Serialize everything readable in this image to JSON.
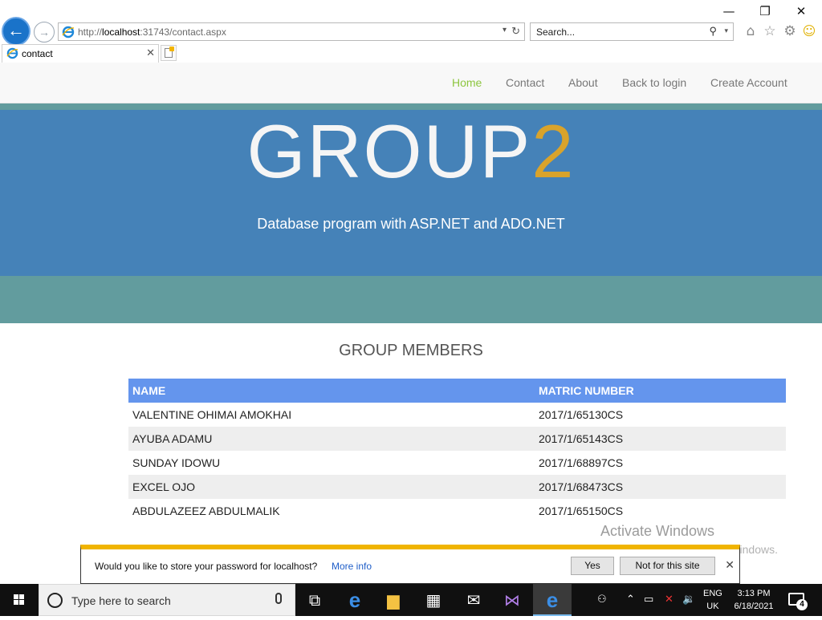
{
  "browser": {
    "url_prefix": "http://",
    "url_host": "localhost",
    "url_rest": ":31743/contact.aspx",
    "search_placeholder": "Search...",
    "tab_title": "contact"
  },
  "nav": {
    "items": [
      {
        "label": "Home",
        "active": true
      },
      {
        "label": "Contact"
      },
      {
        "label": "About"
      },
      {
        "label": "Back to login"
      },
      {
        "label": "Create Account"
      }
    ]
  },
  "hero": {
    "title_text": "GROUP",
    "title_digit": "2",
    "subtitle": "Database program with ASP.NET and ADO.NET"
  },
  "members": {
    "heading": "GROUP MEMBERS",
    "columns": [
      "NAME",
      "MATRIC NUMBER"
    ],
    "rows": [
      [
        "VALENTINE OHIMAI AMOKHAI",
        "2017/1/65130CS"
      ],
      [
        "AYUBA ADAMU",
        "2017/1/65143CS"
      ],
      [
        "SUNDAY IDOWU",
        "2017/1/68897CS"
      ],
      [
        "EXCEL OJO",
        "2017/1/68473CS"
      ],
      [
        "ABDULAZEEZ ABDULMALIK",
        "2017/1/65150CS"
      ]
    ]
  },
  "watermark": {
    "line1": "Activate Windows",
    "line2": "Go to Settings to activate Windows."
  },
  "password_bar": {
    "message": "Would you like to store your password for localhost?",
    "more_info": "More info",
    "yes": "Yes",
    "not_for_site": "Not for this site"
  },
  "taskbar": {
    "search_placeholder": "Type here to search",
    "lang_top": "ENG",
    "lang_bottom": "UK",
    "time": "3:13 PM",
    "date": "6/18/2021",
    "notification_count": "4"
  },
  "colors": {
    "nav_active": "#8dc63f",
    "hero_bg": "#4582b8",
    "hero_strip": "#629c9e",
    "hero_digit": "#d9a32b",
    "table_header": "#6495ed",
    "password_bar_accent": "#f0b400"
  }
}
